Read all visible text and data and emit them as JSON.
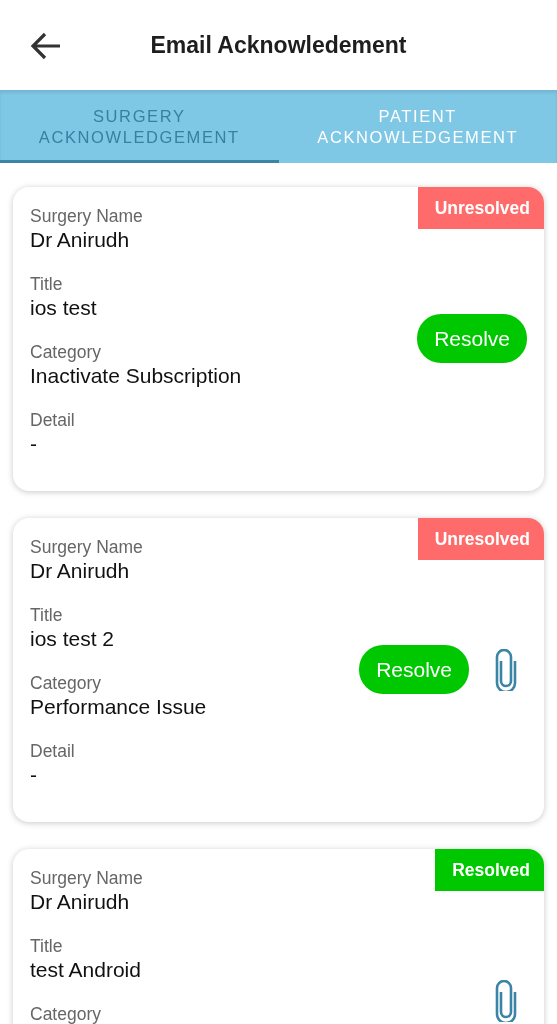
{
  "header": {
    "title": "Email Acknowledement"
  },
  "tabs": [
    {
      "label": "SURGERY\nACKNOWLEDGEMENT",
      "selected": true
    },
    {
      "label": "PATIENT\nACKNOWLEDGEMENT",
      "selected": false
    }
  ],
  "cards": [
    {
      "status": {
        "kind": "unresolved",
        "label": "Unresolved"
      },
      "fields": [
        {
          "label": "Surgery Name",
          "value": "Dr Anirudh"
        },
        {
          "label": "Title",
          "value": "ios test"
        },
        {
          "label": "Category",
          "value": "Inactivate Subscription"
        },
        {
          "label": "Detail",
          "value": "-"
        }
      ],
      "resolve_button": "Resolve",
      "attachment": false
    },
    {
      "status": {
        "kind": "unresolved",
        "label": "Unresolved"
      },
      "fields": [
        {
          "label": "Surgery Name",
          "value": "Dr Anirudh"
        },
        {
          "label": "Title",
          "value": "ios test 2"
        },
        {
          "label": "Category",
          "value": "Performance Issue"
        },
        {
          "label": "Detail",
          "value": "-"
        }
      ],
      "resolve_button": "Resolve",
      "attachment": true
    },
    {
      "status": {
        "kind": "resolved",
        "label": "Resolved"
      },
      "fields": [
        {
          "label": "Surgery Name",
          "value": "Dr Anirudh"
        },
        {
          "label": "Title",
          "value": "test Android"
        },
        {
          "label": "Category"
        }
      ],
      "attachment": true
    }
  ]
}
